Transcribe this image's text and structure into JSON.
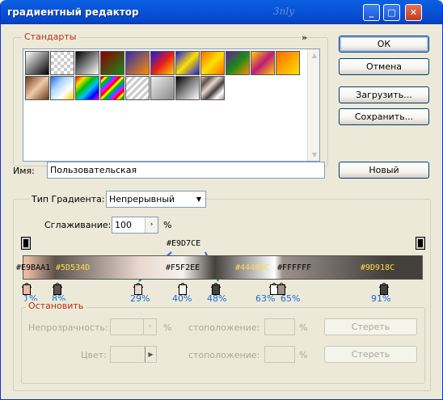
{
  "window": {
    "title": "градиентный редактор",
    "logo": "3nly"
  },
  "titlebar_buttons": {
    "min": "_",
    "max": "□",
    "close": "✕"
  },
  "presets": {
    "label": "Стандарты",
    "menu_arrow": "»"
  },
  "buttons": {
    "ok": "ОК",
    "cancel": "Отмена",
    "load": "Загрузить...",
    "save": "Сохранить...",
    "new": "Новый"
  },
  "name": {
    "label": "Имя:",
    "value": "Пользовательская"
  },
  "gradient_type": {
    "label": "Тип Градиента:",
    "value": "Непрерывный"
  },
  "smoothness": {
    "label": "Сглаживание:",
    "value": "100",
    "unit": "%"
  },
  "color_stops": [
    {
      "hex": "#E9BAA1",
      "percent": "1%",
      "color": "#e9baa1"
    },
    {
      "hex": "#5D534D",
      "percent": "8%",
      "color": "#5d534d"
    },
    {
      "hex": "#E9D7CE",
      "percent": "29%",
      "color": "#e9d7ce"
    },
    {
      "hex": "#F5F2EE",
      "percent": "40%",
      "color": "#f5f2ee"
    },
    {
      "hex": "#44403C",
      "percent": "48%",
      "color": "#44403c"
    },
    {
      "hex": "#FFFFFF",
      "percent": "63%",
      "color": "#ffffff"
    },
    {
      "hex": "#9D918C",
      "percent": "65%",
      "color": "#9d918c"
    },
    {
      "hex": "",
      "percent": "91%",
      "color": "#44403c"
    }
  ],
  "top_label": "#E9D7CE",
  "stops_group": {
    "label": "Остановить",
    "opacity_label": "Непрозрачность:",
    "opacity_unit": "%",
    "location_label": "стоположение:",
    "location_unit": "%",
    "delete_label": "Стереть",
    "color_label": "Цвет:"
  }
}
